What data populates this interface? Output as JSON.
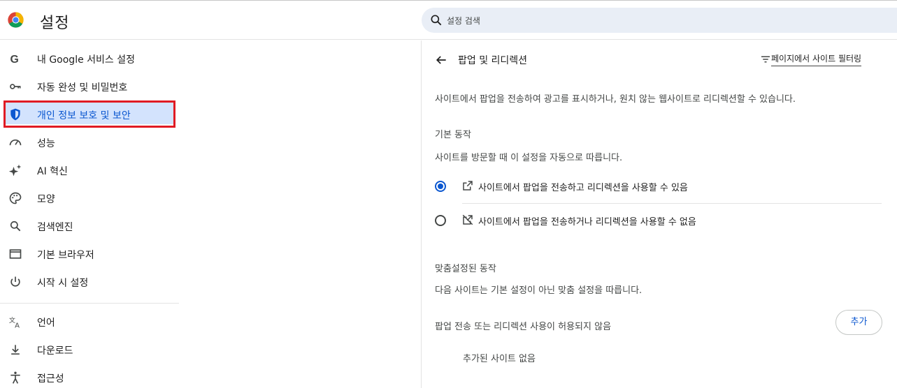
{
  "header": {
    "title": "설정",
    "search_placeholder": "설정 검색"
  },
  "sidebar": {
    "items": [
      {
        "label": "내 Google 서비스 설정",
        "icon": "google-g-icon"
      },
      {
        "label": "자동 완성 및 비밀번호",
        "icon": "key-icon"
      },
      {
        "label": "개인 정보 보호 및 보안",
        "icon": "shield-icon",
        "active": true
      },
      {
        "label": "성능",
        "icon": "speedometer-icon"
      },
      {
        "label": "AI 혁신",
        "icon": "sparkle-icon"
      },
      {
        "label": "모양",
        "icon": "palette-icon"
      },
      {
        "label": "검색엔진",
        "icon": "search-icon"
      },
      {
        "label": "기본 브라우저",
        "icon": "browser-window-icon"
      },
      {
        "label": "시작 시 설정",
        "icon": "power-icon"
      },
      {
        "label": "언어",
        "icon": "translate-icon"
      },
      {
        "label": "다운로드",
        "icon": "download-icon"
      },
      {
        "label": "접근성",
        "icon": "accessibility-icon"
      }
    ]
  },
  "main": {
    "title": "팝업 및 리디렉션",
    "filter_label": "페이지에서 사이트 필터링",
    "description": "사이트에서 팝업을 전송하여 광고를 표시하거나, 원치 않는 웹사이트로 리디렉션할 수 있습니다.",
    "default_heading": "기본 동작",
    "default_desc": "사이트를 방문할 때 이 설정을 자동으로 따릅니다.",
    "options": [
      {
        "label": "사이트에서 팝업을 전송하고 리디렉션을 사용할 수 있음",
        "icon": "open-in-new-icon",
        "checked": true
      },
      {
        "label": "사이트에서 팝업을 전송하거나 리디렉션을 사용할 수 없음",
        "icon": "open-in-new-off-icon",
        "checked": false
      }
    ],
    "custom_heading": "맞춤설정된 동작",
    "custom_desc": "다음 사이트는 기본 설정이 아닌 맞춤 설정을 따릅니다.",
    "blocked_label": "팝업 전송 또는 리디렉션 사용이 허용되지 않음",
    "add_button": "추가",
    "empty_label": "추가된 사이트 없음"
  },
  "colors": {
    "accent": "#0b57d0",
    "active_bg": "#d3e3fd",
    "highlight_red": "#e01b24"
  }
}
